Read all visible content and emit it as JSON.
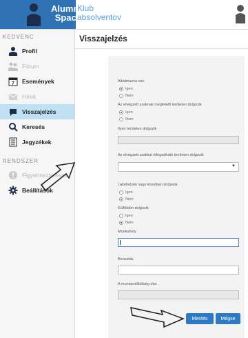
{
  "app": {
    "logo_line1": "Alumni",
    "logo_line2": "Space",
    "logo_side1": "Klub",
    "logo_side2": "absolventov",
    "brand_color": "#2f73b5"
  },
  "sidebar": {
    "section1": "KEDVENC",
    "section2": "RENDSZER",
    "items": [
      {
        "label": "Profil",
        "icon": "person-icon",
        "muted": false
      },
      {
        "label": "Fórum",
        "icon": "people-icon",
        "muted": true
      },
      {
        "label": "Események",
        "icon": "calendar-icon",
        "muted": false
      },
      {
        "label": "Hírek",
        "icon": "mail-icon",
        "muted": true
      },
      {
        "label": "Visszajelzés",
        "icon": "chat-bubble-icon",
        "muted": false,
        "active": true
      },
      {
        "label": "Keresés",
        "icon": "search-icon",
        "muted": false
      },
      {
        "label": "Jegyzékek",
        "icon": "list-icon",
        "muted": false
      }
    ],
    "system_items": [
      {
        "label": "Figyelmeztetések",
        "icon": "alert-icon",
        "muted": true
      },
      {
        "label": "Beállítások",
        "icon": "gear-icon",
        "muted": false
      }
    ]
  },
  "main": {
    "title": "Visszajelzés",
    "form": {
      "q1": "Alkalmazva van",
      "q1_yes": "Igen",
      "q1_no": "Nem",
      "q2": "Az elvégzett szaknak megfelelő területen dolgozik",
      "q2_yes": "Igen",
      "q2_no": "Nem",
      "q3": "Ilyen területen dolgozik",
      "q4": "Az elvégzett szakkal elfogadható területen dolgozik",
      "q5": "Lakóhelyén vagy közelben dolgozik",
      "q5_yes": "Igen",
      "q5_no": "Nem",
      "q6": "Külföldön dolgozik",
      "q6_yes": "Igen",
      "q6_no": "Nem",
      "q7": "Munkahely",
      "q8": "Beosztás",
      "q9": "A munkanélküliség oka"
    },
    "buttons": {
      "save": "Mentés",
      "cancel": "Mégse"
    }
  }
}
